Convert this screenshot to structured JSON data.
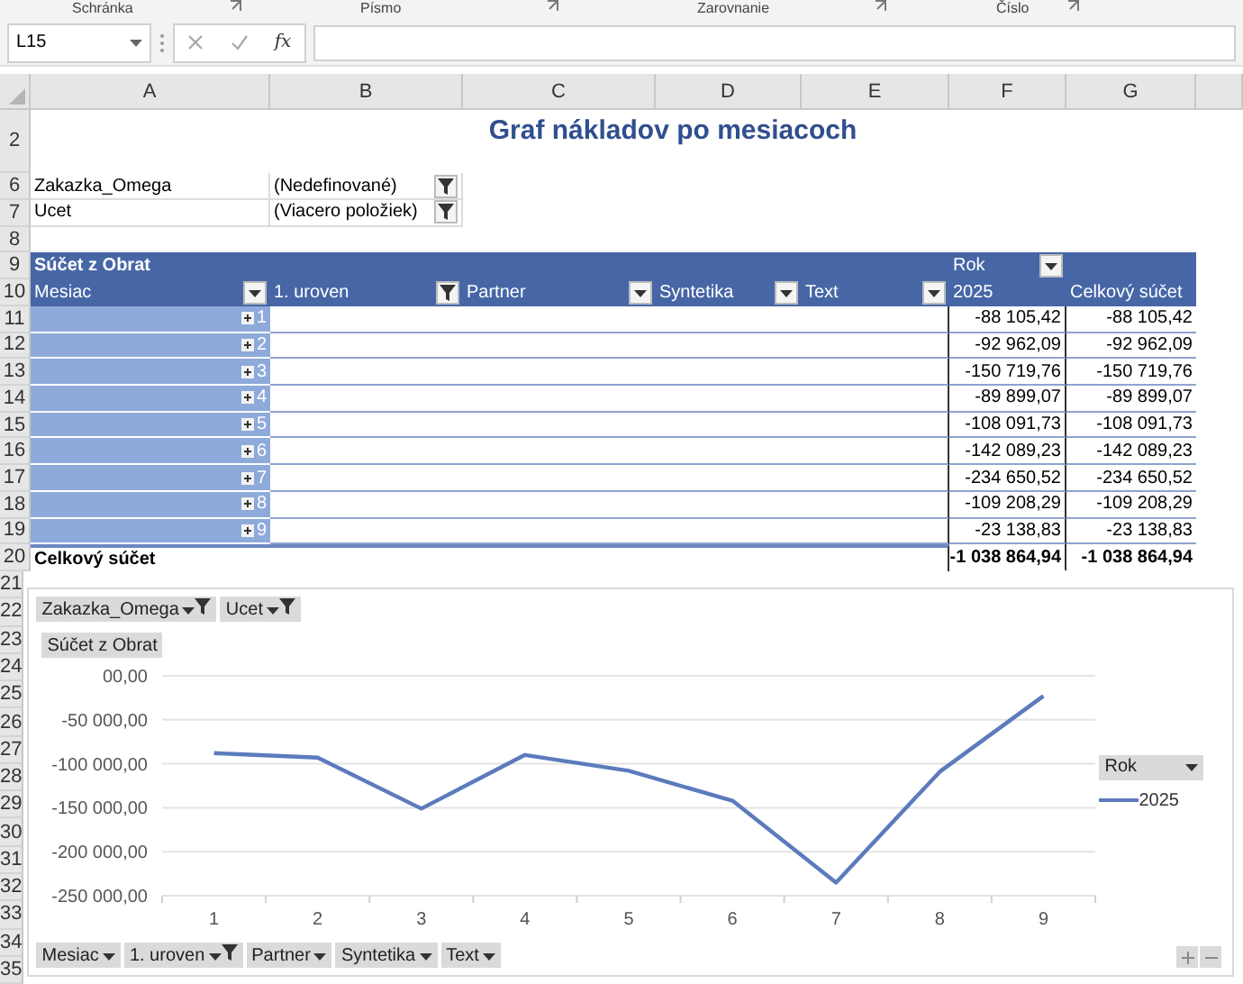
{
  "ribbon_groups": [
    "Schránka",
    "Písmo",
    "Zarovnanie",
    "Číslo"
  ],
  "formula_bar": {
    "name_box": "L15",
    "function_label": "fx"
  },
  "columns": [
    "A",
    "B",
    "C",
    "D",
    "E",
    "F",
    "G"
  ],
  "title": {
    "row": "2",
    "text": "Graf nákladov po mesiacoch"
  },
  "report_filters": [
    {
      "row": "6",
      "field": "Zakazka_Omega",
      "value": "(Nedefinované)",
      "filtered": true
    },
    {
      "row": "7",
      "field": "Ucet",
      "value": "(Viacero položiek)",
      "filtered": true
    }
  ],
  "empty_row": "8",
  "pivot": {
    "header_row": "9",
    "value_label": "Súčet z Obrat",
    "column_field": "Rok",
    "field_row": "10",
    "fields": [
      {
        "label": "Mesiac",
        "filtered": false
      },
      {
        "label": "1. uroven",
        "filtered": true
      },
      {
        "label": "Partner",
        "filtered": false
      },
      {
        "label": "Syntetika",
        "filtered": false
      },
      {
        "label": "Text",
        "filtered": false
      }
    ],
    "column_item": "2025",
    "grand_total_label": "Celkový súčet",
    "rows": [
      {
        "row": "11",
        "label": "1",
        "value": "-88 105,42",
        "total": "-88 105,42"
      },
      {
        "row": "12",
        "label": "2",
        "value": "-92 962,09",
        "total": "-92 962,09"
      },
      {
        "row": "13",
        "label": "3",
        "value": "-150 719,76",
        "total": "-150 719,76"
      },
      {
        "row": "14",
        "label": "4",
        "value": "-89 899,07",
        "total": "-89 899,07"
      },
      {
        "row": "15",
        "label": "5",
        "value": "-108 091,73",
        "total": "-108 091,73"
      },
      {
        "row": "16",
        "label": "6",
        "value": "-142 089,23",
        "total": "-142 089,23"
      },
      {
        "row": "17",
        "label": "7",
        "value": "-234 650,52",
        "total": "-234 650,52"
      },
      {
        "row": "18",
        "label": "8",
        "value": "-109 208,29",
        "total": "-109 208,29"
      },
      {
        "row": "19",
        "label": "9",
        "value": "-23 138,83",
        "total": "-23 138,83"
      }
    ],
    "total_row": {
      "row": "20",
      "label": "Celkový súčet",
      "value": "-1 038 864,94",
      "total": "-1 038 864,94"
    }
  },
  "chart": {
    "row_numbers": [
      "21",
      "22",
      "23",
      "24",
      "25",
      "26",
      "27",
      "28",
      "29",
      "30",
      "31",
      "32",
      "33",
      "34",
      "35"
    ],
    "filter_buttons": [
      {
        "label": "Zakazka_Omega",
        "filtered": true
      },
      {
        "label": "Ucet",
        "filtered": true
      }
    ],
    "value_button": "Súčet z Obrat",
    "axis_buttons": [
      {
        "label": "Mesiac",
        "filtered": false
      },
      {
        "label": "1. uroven",
        "filtered": true
      },
      {
        "label": "Partner",
        "filtered": false
      },
      {
        "label": "Syntetika",
        "filtered": false
      },
      {
        "label": "Text",
        "filtered": false
      }
    ],
    "legend_button": "Rok",
    "chart_data": {
      "type": "line",
      "categories": [
        "1",
        "2",
        "3",
        "4",
        "5",
        "6",
        "7",
        "8",
        "9"
      ],
      "series": [
        {
          "name": "2025",
          "color": "#5b7bbd",
          "values": [
            -88000,
            -93000,
            -151000,
            -90000,
            -108000,
            -142000,
            -235000,
            -109000,
            -23000
          ]
        }
      ],
      "grid": true,
      "ylim": [
        -250000,
        0
      ],
      "yticks": [
        {
          "value": 0,
          "label": "00,00"
        },
        {
          "value": -50000,
          "label": "-50 000,00"
        },
        {
          "value": -100000,
          "label": "-100 000,00"
        },
        {
          "value": -150000,
          "label": "-150 000,00"
        },
        {
          "value": -200000,
          "label": "-200 000,00"
        },
        {
          "value": -250000,
          "label": "-250 000,00"
        }
      ]
    }
  }
}
